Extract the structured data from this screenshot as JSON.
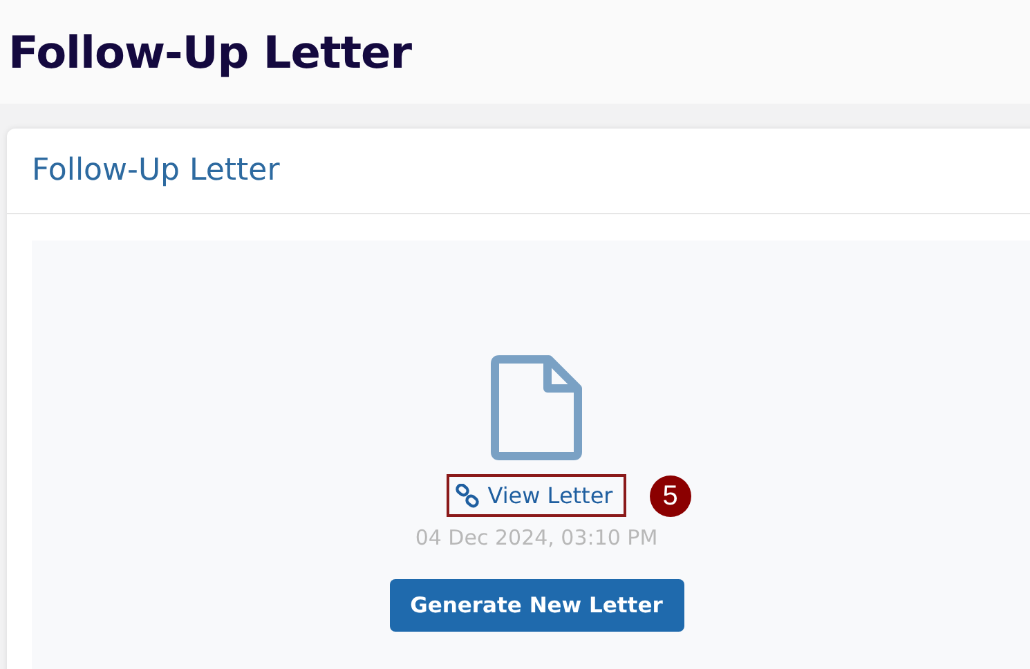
{
  "page_title": "Follow-Up Letter",
  "card": {
    "title": "Follow-Up Letter",
    "document": {
      "link": "View Letter",
      "timestamp": "04 Dec 2024, 03:10 PM",
      "button": "Generate New Letter"
    }
  },
  "annotation": {
    "number": "5",
    "highlighted": true
  }
}
